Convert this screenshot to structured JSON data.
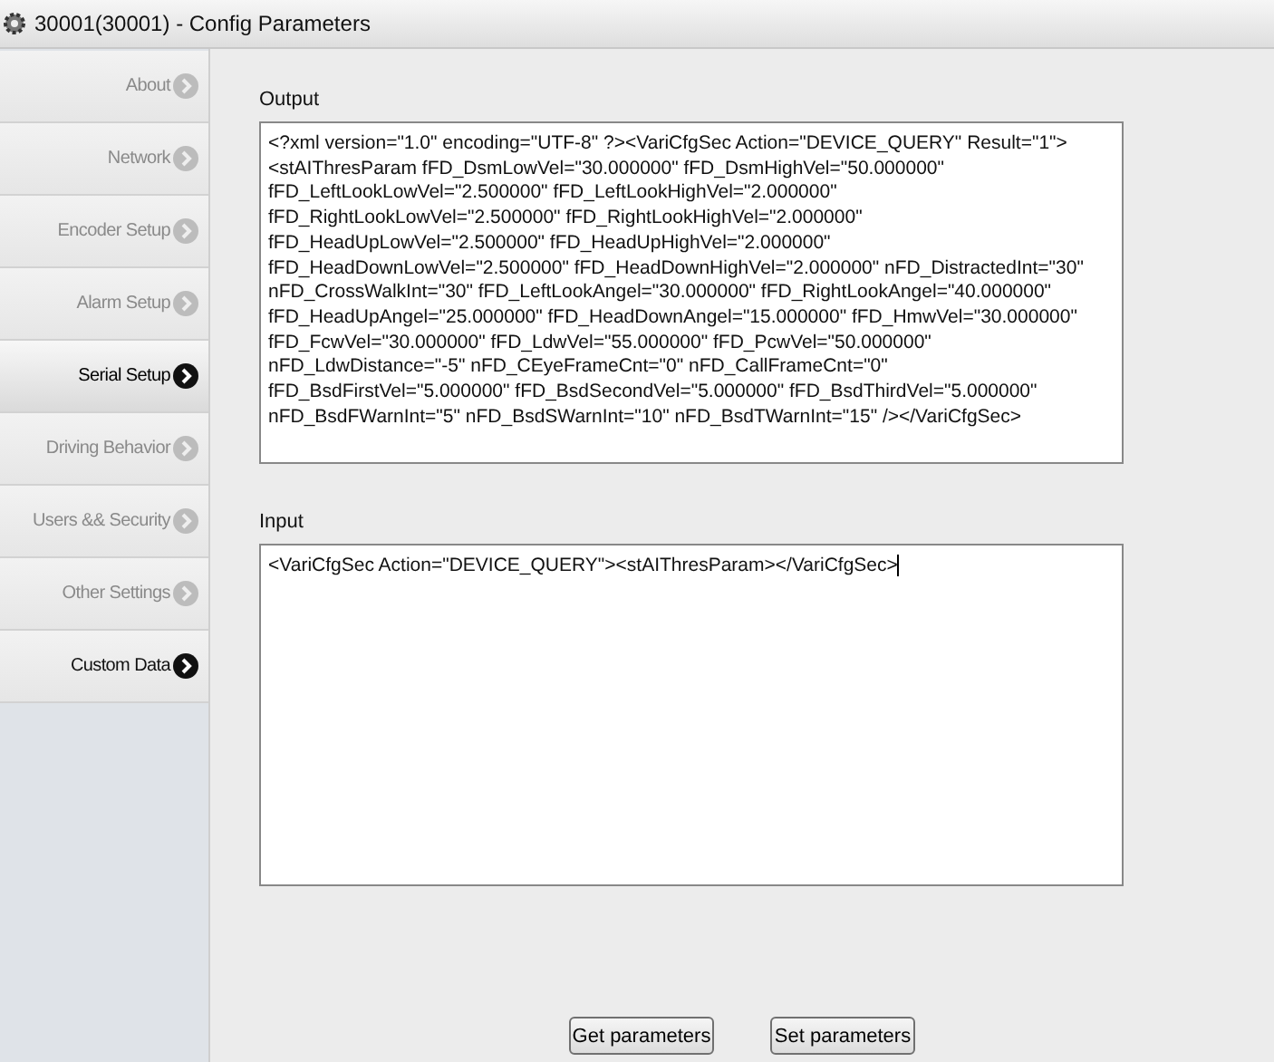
{
  "window": {
    "title": "30001(30001) - Config Parameters"
  },
  "sidebar": {
    "items": [
      {
        "label": "About",
        "selected": false,
        "disabled": true
      },
      {
        "label": "Network",
        "selected": false,
        "disabled": true
      },
      {
        "label": "Encoder Setup",
        "selected": false,
        "disabled": true
      },
      {
        "label": "Alarm Setup",
        "selected": false,
        "disabled": true
      },
      {
        "label": "Serial Setup",
        "selected": true,
        "disabled": false
      },
      {
        "label": "Driving Behavior",
        "selected": false,
        "disabled": true
      },
      {
        "label": "Users && Security",
        "selected": false,
        "disabled": true
      },
      {
        "label": "Other Settings",
        "selected": false,
        "disabled": true
      },
      {
        "label": "Custom Data",
        "selected": false,
        "disabled": false
      }
    ]
  },
  "output": {
    "label": "Output",
    "lines": [
      "<?xml version=\"1.0\" encoding=\"UTF-8\" ?><VariCfgSec Action=\"DEVICE_QUERY\" Result=\"1\">",
      "<stAIThresParam fFD_DsmLowVel=\"30.000000\" fFD_DsmHighVel=\"50.000000\"",
      "fFD_LeftLookLowVel=\"2.500000\" fFD_LeftLookHighVel=\"2.000000\"",
      "fFD_RightLookLowVel=\"2.500000\" fFD_RightLookHighVel=\"2.000000\"",
      "fFD_HeadUpLowVel=\"2.500000\" fFD_HeadUpHighVel=\"2.000000\"",
      "fFD_HeadDownLowVel=\"2.500000\" fFD_HeadDownHighVel=\"2.000000\" nFD_DistractedInt=\"30\"",
      "nFD_CrossWalkInt=\"30\" fFD_LeftLookAngel=\"30.000000\" fFD_RightLookAngel=\"40.000000\"",
      "fFD_HeadUpAngel=\"25.000000\" fFD_HeadDownAngel=\"15.000000\" fFD_HmwVel=\"30.000000\"",
      "fFD_FcwVel=\"30.000000\" fFD_LdwVel=\"55.000000\" fFD_PcwVel=\"50.000000\"",
      "nFD_LdwDistance=\"-5\" nFD_CEyeFrameCnt=\"0\" nFD_CallFrameCnt=\"0\"",
      "fFD_BsdFirstVel=\"5.000000\" fFD_BsdSecondVel=\"5.000000\" fFD_BsdThirdVel=\"5.000000\"",
      "nFD_BsdFWarnInt=\"5\" nFD_BsdSWarnInt=\"10\" nFD_BsdTWarnInt=\"15\" /></VariCfgSec>"
    ]
  },
  "input": {
    "label": "Input",
    "value": "<VariCfgSec Action=\"DEVICE_QUERY\"><stAIThresParam></VariCfgSec>"
  },
  "buttons": [
    "Get parameters",
    "Set parameters"
  ]
}
